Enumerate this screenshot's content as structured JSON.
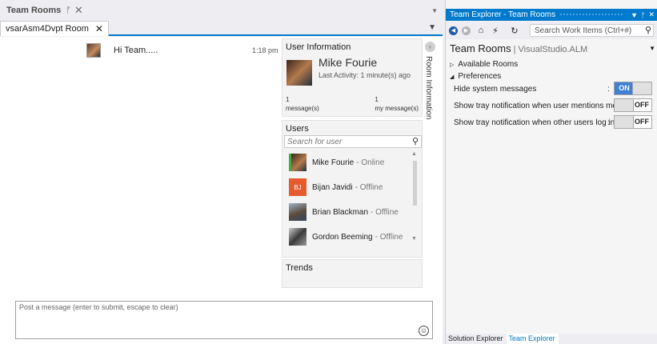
{
  "doc_window": {
    "title": "Team Rooms",
    "pin_icon": "pin-icon",
    "close_icon": "close-icon",
    "room_tab": {
      "label": "vsarAsm4Dvpt Room",
      "close": "✕"
    }
  },
  "chat": {
    "messages": [
      {
        "text": "Hi Team.....",
        "time": "1:18 pm"
      }
    ]
  },
  "user_info": {
    "heading": "User Information",
    "name": "Mike Fourie",
    "last_activity": "Last Activity: 1 minute(s) ago",
    "message_count": "1",
    "message_count_label": "message(s)",
    "my_message_count": "1",
    "my_message_label": "my message(s)"
  },
  "users": {
    "heading": "Users",
    "search_placeholder": "Search for user",
    "list": [
      {
        "name": "Mike Fourie",
        "status": "- Online",
        "initials": "",
        "color": "#7a5135",
        "status_color": "#3cb043"
      },
      {
        "name": "Bijan Javidi",
        "status": "- Offline",
        "initials": "BJ",
        "color": "#e55b2d",
        "status_color": ""
      },
      {
        "name": "Brian Blackman",
        "status": "- Offline",
        "initials": "",
        "color": "#6b7c93",
        "status_color": ""
      },
      {
        "name": "Gordon Beeming",
        "status": "- Offline",
        "initials": "",
        "color": "#8a8a8a",
        "status_color": ""
      }
    ]
  },
  "trends": {
    "heading": "Trends"
  },
  "room_info_rail": {
    "label": "Room Information",
    "button": "›"
  },
  "composer": {
    "placeholder": "Post a message (enter to submit, escape to clear)",
    "emoji": "☺"
  },
  "team_explorer": {
    "title": "Team Explorer - Team Rooms",
    "search_placeholder": "Search Work Items (Ctrl+#)",
    "header_main": "Team Rooms",
    "header_sub": " | VisualStudio.ALM",
    "available_rooms": "Available Rooms",
    "preferences": "Preferences",
    "prefs": [
      {
        "label": "Hide system messages",
        "colon": ":",
        "value": "ON"
      },
      {
        "label": "Show tray notification when user mentions me :",
        "colon": "",
        "value": "OFF"
      },
      {
        "label": "Show tray notification when other users log in",
        "colon": ":",
        "value": "OFF"
      }
    ]
  },
  "bottom_tabs": [
    "Solution Explorer",
    "Team Explorer"
  ],
  "colors": {
    "accent": "#007acc",
    "toggle_on": "#3f7fd4"
  }
}
